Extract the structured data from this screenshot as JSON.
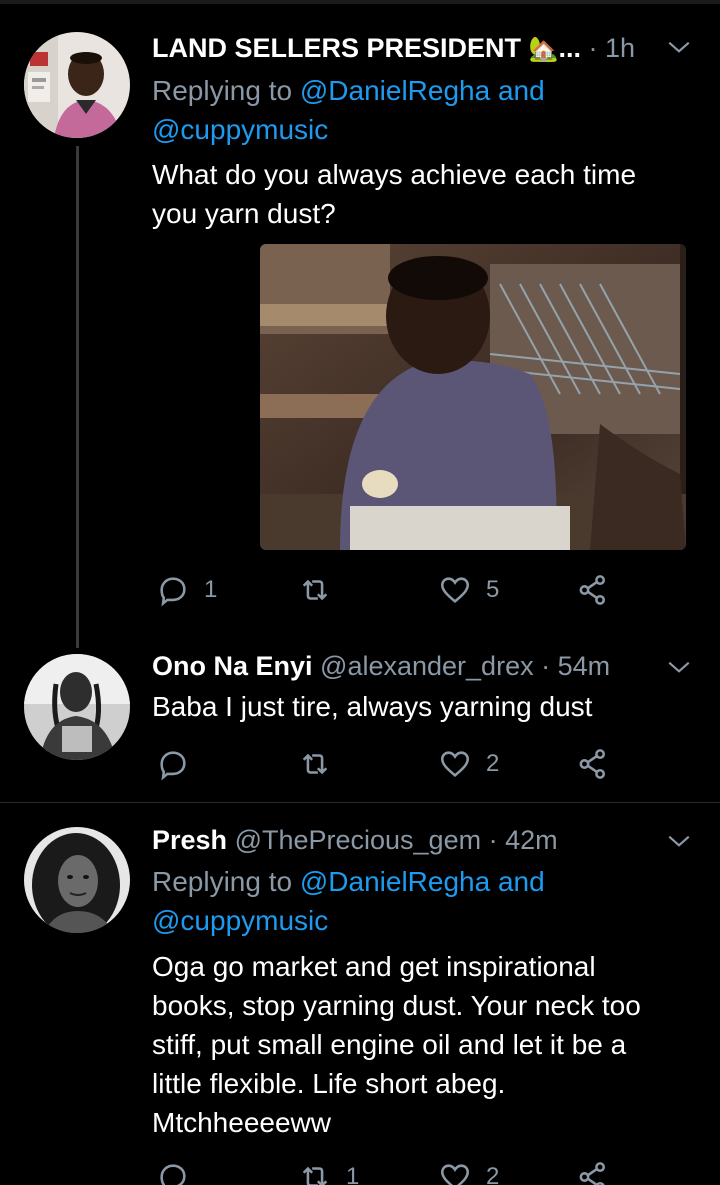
{
  "colors": {
    "background": "#000000",
    "accent": "#1d9bf0",
    "secondary_text": "#8b98a5",
    "divider": "#2a2a2a"
  },
  "tweets": [
    {
      "display_name": "LAND SELLERS PRESIDENT",
      "name_emoji": "🏡",
      "truncation": "...",
      "separator": "·",
      "time": "1h",
      "reply_prefix": "Replying to",
      "reply_line1_mentions": "@DanielRegha and",
      "reply_line2_mentions": "@cuppymusic",
      "text_line1": "What do you always achieve each time",
      "text_line2": "you yarn dust?",
      "reply_count": "1",
      "retweet_count": "",
      "like_count": "5"
    },
    {
      "display_name": "Ono Na Enyi",
      "handle": "@alexander_drex",
      "separator": "·",
      "time": "54m",
      "text_line1": "Baba I just tire, always yarning dust",
      "reply_count": "",
      "retweet_count": "",
      "like_count": "2"
    },
    {
      "display_name": "Presh",
      "handle": "@ThePrecious_gem",
      "separator": "·",
      "time": "42m",
      "reply_prefix": "Replying to",
      "reply_line1_mentions": "@DanielRegha and",
      "reply_line2_mentions": "@cuppymusic",
      "text_line1": "Oga go market and get inspirational",
      "text_line2": "books, stop yarning dust. Your neck too",
      "text_line3": "stiff, put small engine oil and let it be a",
      "text_line4": "little flexible. Life short abeg.",
      "text_line5": "Mtchheeeeww",
      "reply_count": "",
      "retweet_count": "1",
      "like_count": "2"
    }
  ],
  "icons": {
    "reply": "reply-icon",
    "retweet": "retweet-icon",
    "like": "heart-icon",
    "share": "share-icon",
    "more": "chevron-down-icon"
  }
}
